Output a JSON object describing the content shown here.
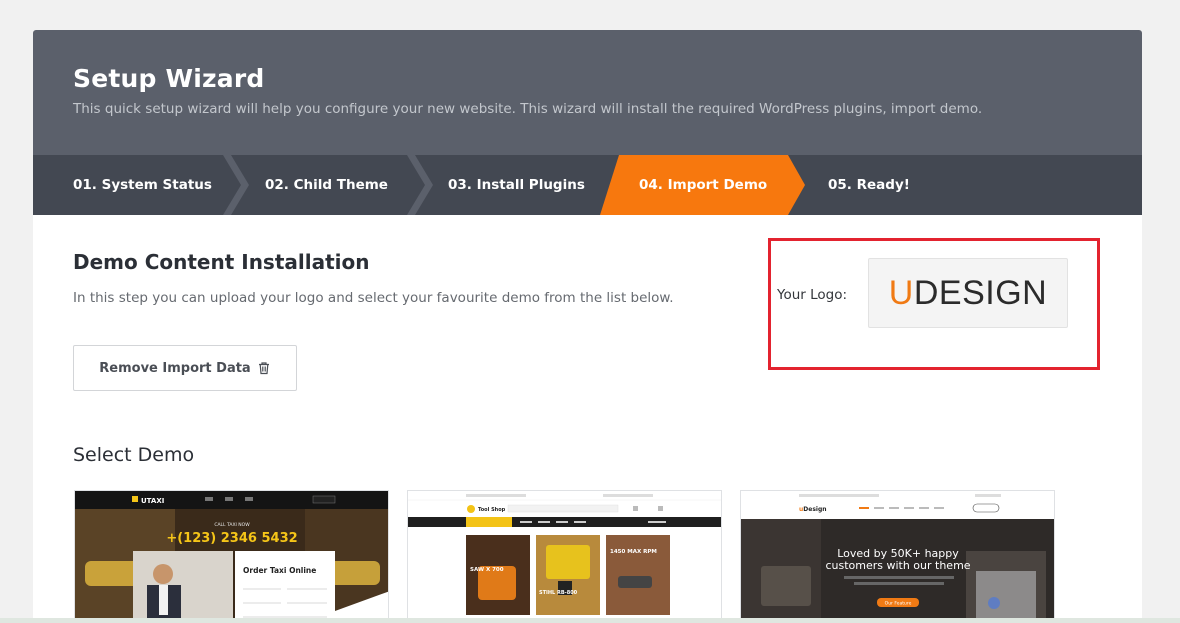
{
  "header": {
    "title": "Setup Wizard",
    "subtitle": "This quick setup wizard will help you configure your new website. This wizard will install the required WordPress plugins, import demo."
  },
  "steps": [
    {
      "label": "01. System Status",
      "active": false
    },
    {
      "label": "02. Child Theme",
      "active": false
    },
    {
      "label": "03. Install Plugins",
      "active": false
    },
    {
      "label": "04. Import Demo",
      "active": true
    },
    {
      "label": "05. Ready!",
      "active": false
    }
  ],
  "content": {
    "title": "Demo Content Installation",
    "description": "In this step you can upload your logo and select your favourite demo from the list below.",
    "remove_button": "Remove Import Data"
  },
  "logo": {
    "label": "Your Logo:",
    "brand_first": "U",
    "brand_rest": "DESIGN"
  },
  "select_demo": {
    "title": "Select Demo",
    "demos": [
      {
        "name": "taxi",
        "brand": "UTAXI",
        "call_label": "CALL TAXI NOW",
        "phone": "+(123) 2346 5432",
        "form_title": "Order Taxi Online"
      },
      {
        "name": "tool-shop",
        "brand": "Tool Shop",
        "promo1_title": "SAW X 700",
        "promo2_title": "STIHL RB-800",
        "promo3_title": "1450 MAX RPM"
      },
      {
        "name": "udesign",
        "brand_first": "u",
        "brand_rest": "Design",
        "headline_line1": "Loved by 50K+ happy",
        "headline_line2": "customers with our theme",
        "cta": "Our Feature"
      }
    ]
  },
  "colors": {
    "header_bg": "#5b606b",
    "steps_bg": "#434852",
    "active_step": "#f7780e",
    "highlight_border": "#e3232f",
    "brand_orange": "#f07a14"
  }
}
